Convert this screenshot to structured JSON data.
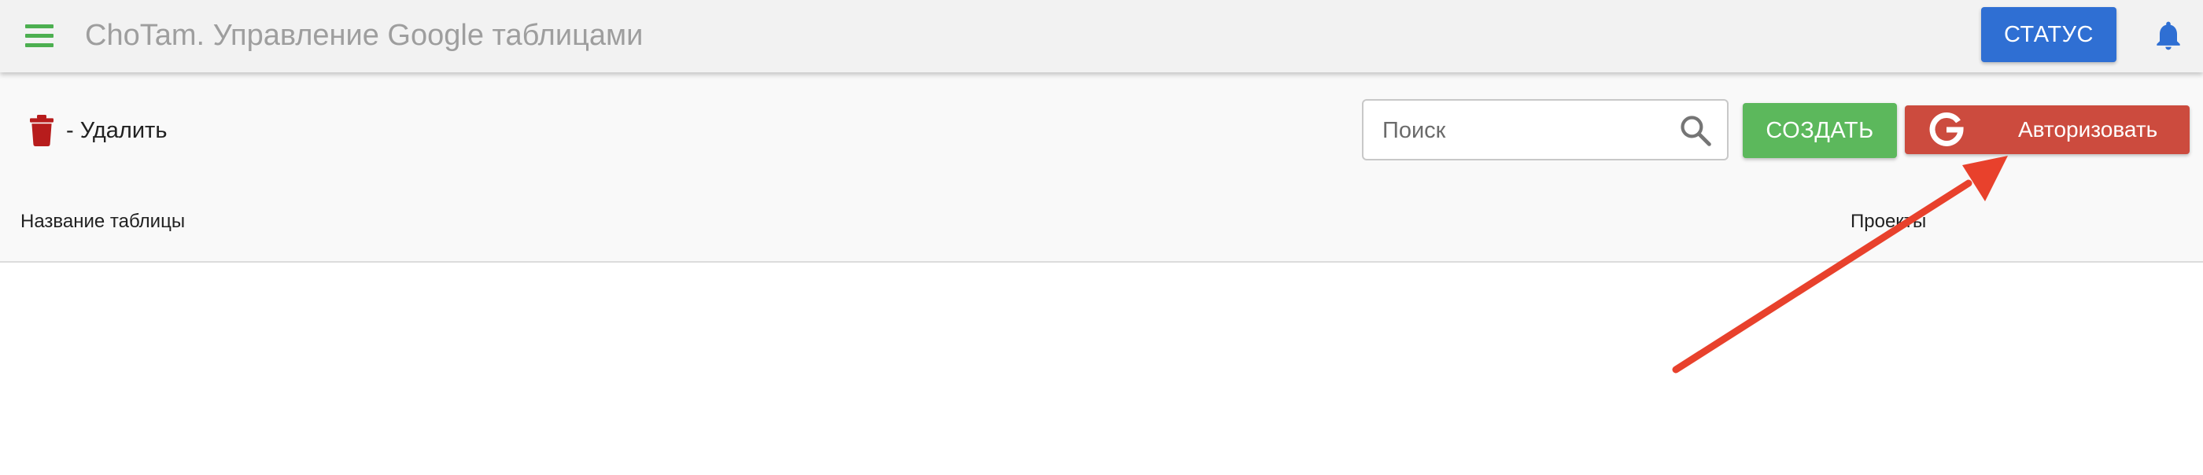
{
  "header": {
    "title": "ChoTam. Управление Google таблицами",
    "status_button": "СТАТУС",
    "menu_icon": "menu-icon",
    "notification_icon": "bell-icon"
  },
  "toolbar": {
    "delete_legend": {
      "icon": "trash-icon",
      "label": "- Удалить"
    },
    "search": {
      "placeholder": "Поиск",
      "value": "",
      "icon": "search-icon"
    },
    "create_button": "СОЗДАТЬ",
    "authorize_button": {
      "icon": "google-g-icon",
      "label": "Авторизовать"
    }
  },
  "table": {
    "columns": [
      "Название таблицы",
      "Проекты"
    ],
    "rows": []
  },
  "colors": {
    "accent_green": "#5cb85c",
    "menu_icon_green": "#4caf50",
    "status_blue": "#2f6fd3",
    "bell_blue": "#2f6fd3",
    "google_red": "#cc4b3e",
    "trash_red": "#b71c1c",
    "annotation_arrow": "#e8412c",
    "title_grey": "#9e9e9e",
    "topbar_bg": "#f2f2f2"
  }
}
